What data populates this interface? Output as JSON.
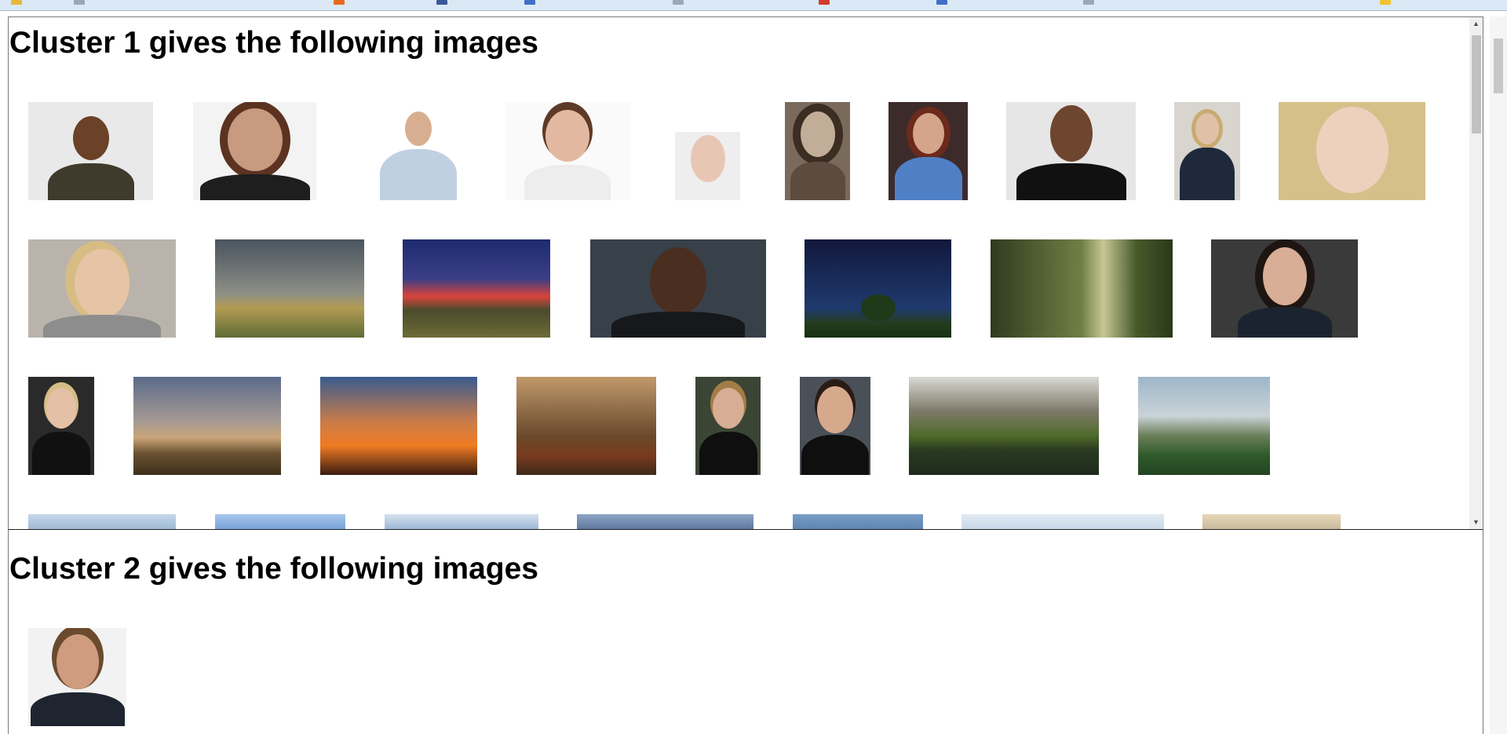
{
  "clusters": [
    {
      "title": "Cluster 1 gives the following images"
    },
    {
      "title": "Cluster 2 gives the following images"
    }
  ],
  "colors": {
    "frame_border": "#7a7a7a",
    "browser_bar": "#dbe9f6"
  },
  "icons": {
    "scroll_up": "▲",
    "scroll_down": "▼"
  }
}
